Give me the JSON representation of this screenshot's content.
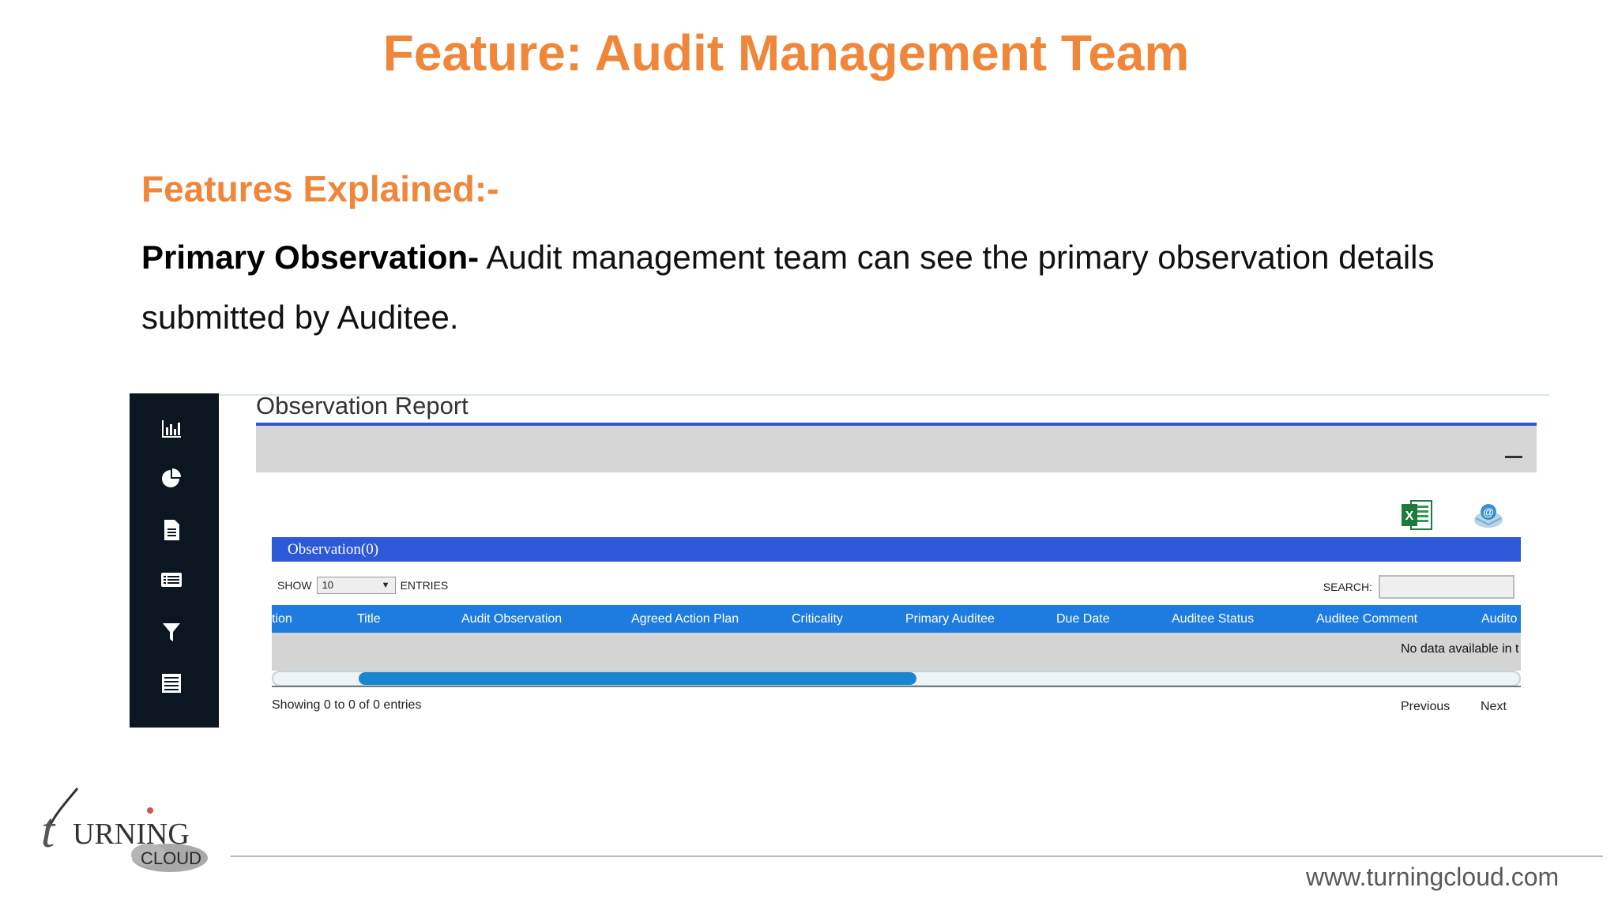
{
  "slide": {
    "title": "Feature: Audit Management Team",
    "sub_heading": "Features Explained:-",
    "body_bold": "Primary Observation-",
    "body_text": " Audit management team can see the primary observation details submitted by Auditee."
  },
  "report": {
    "title": "Observation Report",
    "observation_label": "Observation(0)",
    "show_label": "SHOW",
    "show_value": "10",
    "entries_label": "ENTRIES",
    "search_label": "SEARCH:",
    "columns": [
      "tion",
      "Title",
      "Audit Observation",
      "Agreed Action Plan",
      "Criticality",
      "Primary Auditee",
      "Due Date",
      "Auditee Status",
      "Auditee Comment",
      "Audito"
    ],
    "empty_message": "No data available in t",
    "info_text": "Showing 0 to 0 of 0 entries",
    "previous_label": "Previous",
    "next_label": "Next"
  },
  "sidebar": {
    "icons": [
      "bar-chart-icon",
      "pie-chart-icon",
      "document-icon",
      "list-card-icon",
      "filter-icon",
      "table-list-icon"
    ]
  },
  "footer": {
    "logo_word": "URNING",
    "logo_letter": "t",
    "logo_sub": "CLOUD",
    "url": "www.turningcloud.com"
  },
  "colors": {
    "accent_orange": "#ef8639",
    "header_blue": "#2d58d8",
    "table_blue": "#1e7ce0",
    "sidebar_dark": "#0b1620"
  }
}
